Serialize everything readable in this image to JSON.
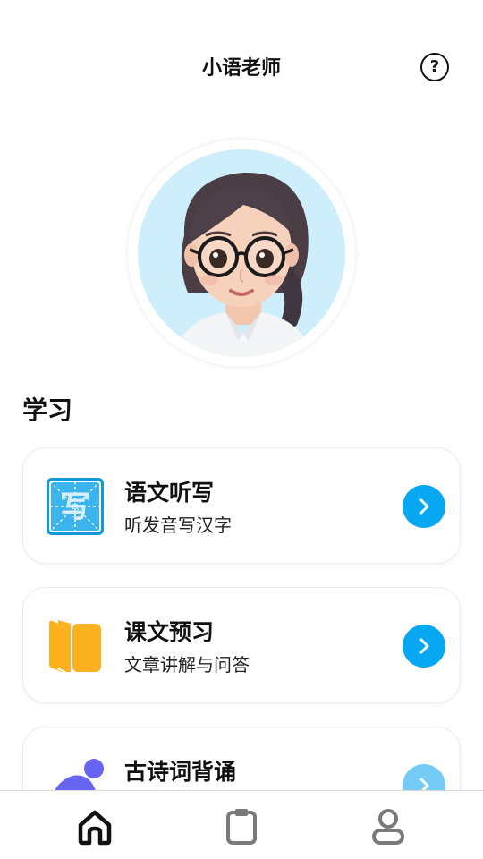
{
  "header": {
    "title": "小语老师",
    "help_label": "?"
  },
  "avatar": {
    "alt": "小语老师头像"
  },
  "section": {
    "title": "学习"
  },
  "cards": [
    {
      "title": "语文听写",
      "subtitle": "听发音写汉字",
      "icon": "dictation-icon",
      "icon_glyph": "写"
    },
    {
      "title": "课文预习",
      "subtitle": "文章讲解与问答",
      "icon": "book-icon"
    },
    {
      "title": "古诗词背诵",
      "subtitle": "",
      "icon": "poetry-icon"
    }
  ],
  "nav": {
    "items": [
      {
        "icon": "home-icon",
        "active": true
      },
      {
        "icon": "clipboard-icon",
        "active": false
      },
      {
        "icon": "user-icon",
        "active": false
      }
    ]
  },
  "colors": {
    "accent": "#08a7f2",
    "active_nav": "#111111",
    "inactive_nav": "#7a7a7a",
    "book_yellow": "#fbb21e",
    "poetry_purple": "#6664f1"
  }
}
